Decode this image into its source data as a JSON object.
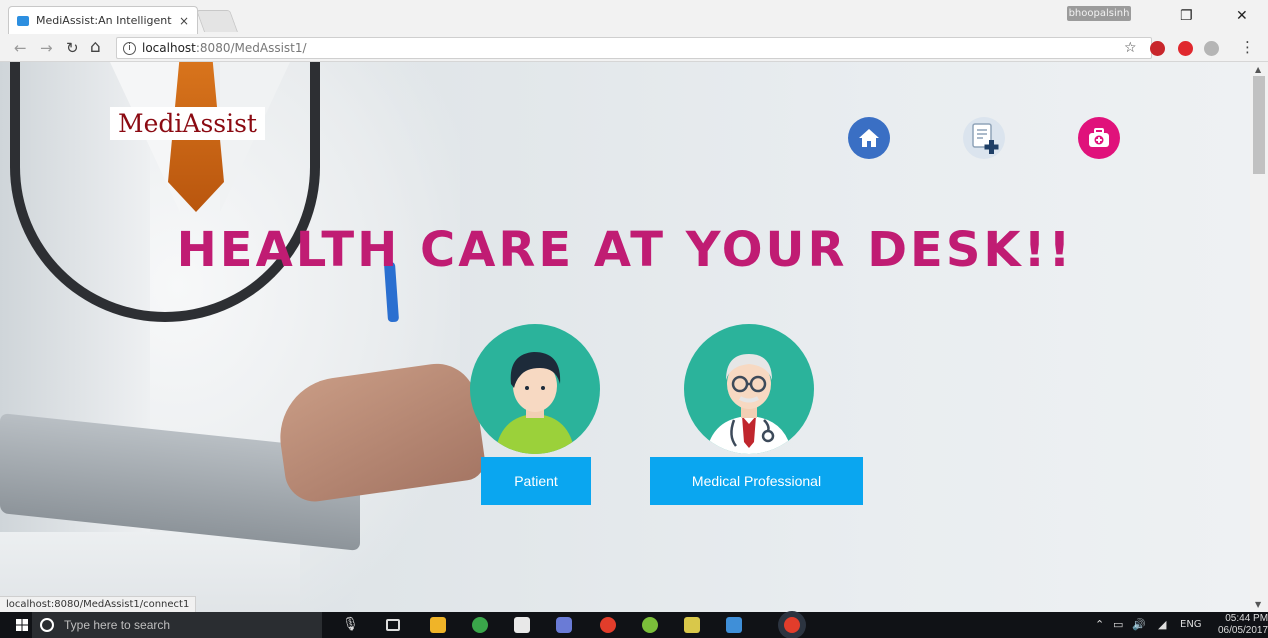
{
  "browser": {
    "tab_title": "MediAssist:An Intelligent",
    "tab_close": "×",
    "profile_name": "bhoopalsinh",
    "window_restore": "❐",
    "window_close": "✕",
    "url_host": "localhost",
    "url_path": ":8080/MedAssist1/",
    "status_url": "localhost:8080/MedAssist1/connect1"
  },
  "page": {
    "logo_text": "MediAssist",
    "headline": "HEALTH CARE AT YOUR DESK!!",
    "nav_icons": [
      "home-icon",
      "medical-report-icon",
      "first-aid-kit-icon"
    ],
    "roles": [
      {
        "label": "Patient"
      },
      {
        "label": "Medical Professional"
      }
    ],
    "colors": {
      "headline": "#c01c73",
      "button": "#0aa6f0",
      "avatar_bg": "#2bb39b",
      "home": "#3a6fc4",
      "first_aid": "#e0127b"
    }
  },
  "taskbar": {
    "search_placeholder": "Type here to search",
    "tray_lang": "ENG",
    "time": "05:44 PM",
    "date": "06/05/2017"
  }
}
